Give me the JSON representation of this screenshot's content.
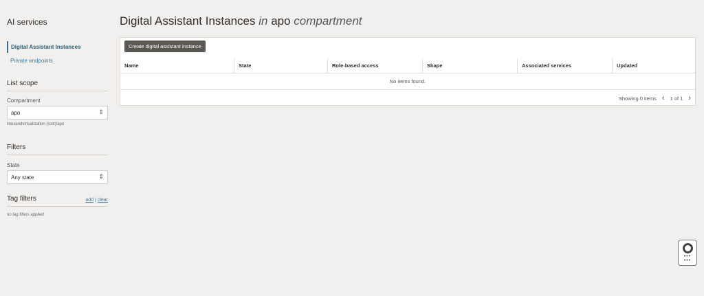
{
  "sidebar": {
    "title": "AI services",
    "nav": [
      {
        "label": "Digital Assistant Instances",
        "active": true
      },
      {
        "label": "Private endpoints"
      }
    ],
    "list_scope": {
      "heading": "List scope",
      "compartment_label": "Compartment",
      "compartment_value": "apo",
      "compartment_path": "linuxandvirtualization (root)/apo"
    },
    "filters": {
      "heading": "Filters",
      "state_label": "State",
      "state_value": "Any state"
    },
    "tag_filters": {
      "heading": "Tag filters",
      "add": "add",
      "separator": "|",
      "clear": "clear",
      "empty": "no tag filters applied"
    }
  },
  "header": {
    "title_main": "Digital Assistant Instances",
    "title_in": "in",
    "title_compartment": "apo",
    "title_suffix": "compartment"
  },
  "table": {
    "create_button": "Create digital assistant instance",
    "columns": [
      "Name",
      "State",
      "Role-based access",
      "Shape",
      "Associated services",
      "Updated"
    ],
    "empty_text": "No items found.",
    "showing": "Showing 0 items",
    "pagination": "1 of 1"
  },
  "icons": {
    "help": "lifebuoy-icon",
    "apps": "grid-icon"
  }
}
